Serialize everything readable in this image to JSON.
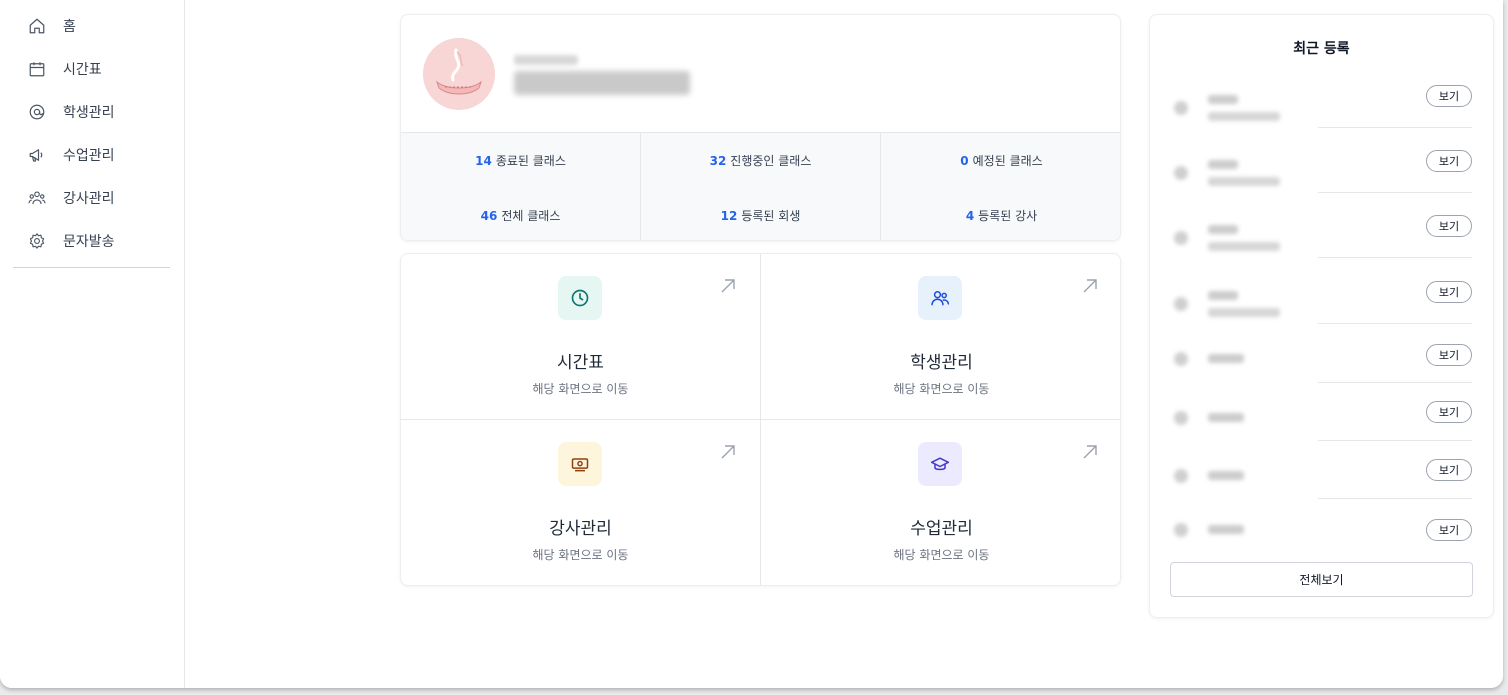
{
  "sidebar": {
    "items": [
      {
        "label": "홈",
        "icon": "home-icon"
      },
      {
        "label": "시간표",
        "icon": "calendar-icon"
      },
      {
        "label": "학생관리",
        "icon": "at-sign-icon"
      },
      {
        "label": "수업관리",
        "icon": "megaphone-icon"
      },
      {
        "label": "강사관리",
        "icon": "users-icon"
      },
      {
        "label": "문자발송",
        "icon": "gear-icon"
      }
    ]
  },
  "profile": {
    "avatar": "academy-logo"
  },
  "stats": [
    {
      "num": "14",
      "label": "종료된 클래스"
    },
    {
      "num": "32",
      "label": "진행중인 클래스"
    },
    {
      "num": "0",
      "label": "예정된 클래스"
    },
    {
      "num": "46",
      "label": "전체 클래스"
    },
    {
      "num": "12",
      "label": "등록된 회생"
    },
    {
      "num": "4",
      "label": "등록된 강사"
    }
  ],
  "quick_links": [
    {
      "title": "시간표",
      "subtitle": "해당 화면으로 이동",
      "icon": "clock-icon",
      "icon_bg": "#e6f6f3",
      "icon_color": "#0f766e"
    },
    {
      "title": "학생관리",
      "subtitle": "해당 화면으로 이동",
      "icon": "users-icon",
      "icon_bg": "#e7f1fb",
      "icon_color": "#1d4ed8"
    },
    {
      "title": "강사관리",
      "subtitle": "해당 화면으로 이동",
      "icon": "banknote-icon",
      "icon_bg": "#fdf6dc",
      "icon_color": "#92400e"
    },
    {
      "title": "수업관리",
      "subtitle": "해당 화면으로 이동",
      "icon": "graduation-cap-icon",
      "icon_bg": "#eceafe",
      "icon_color": "#4338ca"
    }
  ],
  "recent": {
    "title": "최근 등록",
    "view_label": "보기",
    "view_all_label": "전체보기"
  },
  "colors": {
    "accent": "#2563eb"
  }
}
